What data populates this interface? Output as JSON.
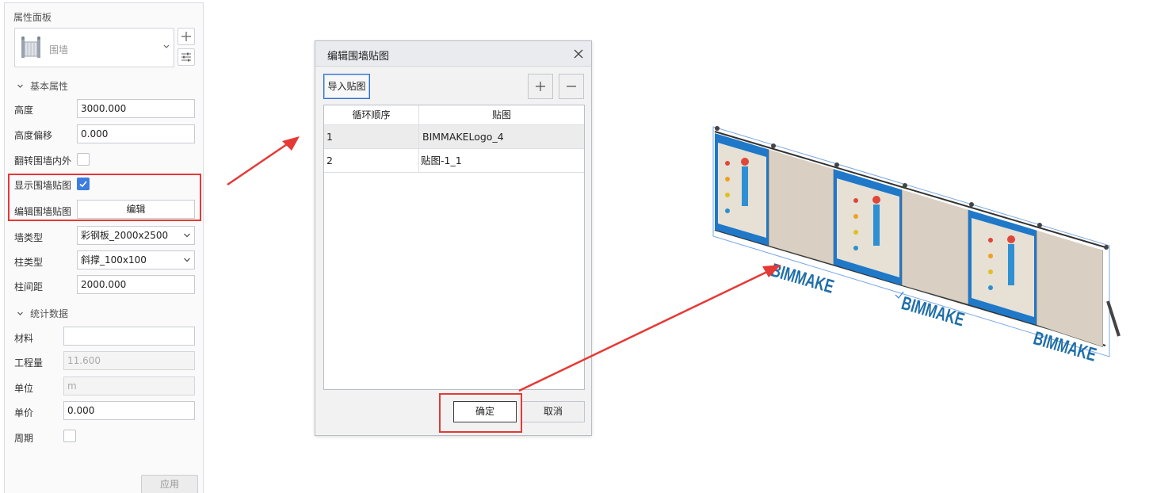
{
  "panel": {
    "title": "属性面板",
    "type_selector": {
      "value": "围墙",
      "icon": "fence-icon"
    },
    "add_icon": "plus-icon",
    "settings_icon": "sliders-icon",
    "basic": {
      "title": "基本属性",
      "height": {
        "label": "高度",
        "value": "3000.000"
      },
      "height_offset": {
        "label": "高度偏移",
        "value": "0.000"
      },
      "flip": {
        "label": "翻转围墙内外",
        "checked": false
      },
      "show_texture": {
        "label": "显示围墙贴图",
        "checked": true
      },
      "edit_texture": {
        "label": "编辑围墙贴图",
        "button": "编辑"
      },
      "wall_type": {
        "label": "墙类型",
        "value": "彩钢板_2000x2500"
      },
      "column_type": {
        "label": "柱类型",
        "value": "斜撑_100x100"
      },
      "column_spacing": {
        "label": "柱间距",
        "value": "2000.000"
      }
    },
    "stats": {
      "title": "统计数据",
      "material": {
        "label": "材料",
        "value": ""
      },
      "quantity": {
        "label": "工程量",
        "value": "11.600"
      },
      "unit": {
        "label": "单位",
        "value": "m"
      },
      "unit_price": {
        "label": "单价",
        "value": "0.000"
      },
      "period": {
        "label": "周期",
        "checked": false
      }
    },
    "apply_label": "应用"
  },
  "dialog": {
    "title": "编辑围墙贴图",
    "import_label": "导入贴图",
    "columns": [
      "循环顺序",
      "贴图"
    ],
    "rows": [
      {
        "order": "1",
        "texture": "BIMMAKELogo_4"
      },
      {
        "order": "2",
        "texture": "贴图-1_1"
      }
    ],
    "ok_label": "确定",
    "cancel_label": "取消"
  },
  "viewport": {
    "panel_logo_text": "BIMMAKE",
    "colors": {
      "accent": "#3d7de0",
      "highlight": "#e53935",
      "panel_blue": "#1f78c8",
      "panel_beige": "#d9d0c3"
    }
  }
}
